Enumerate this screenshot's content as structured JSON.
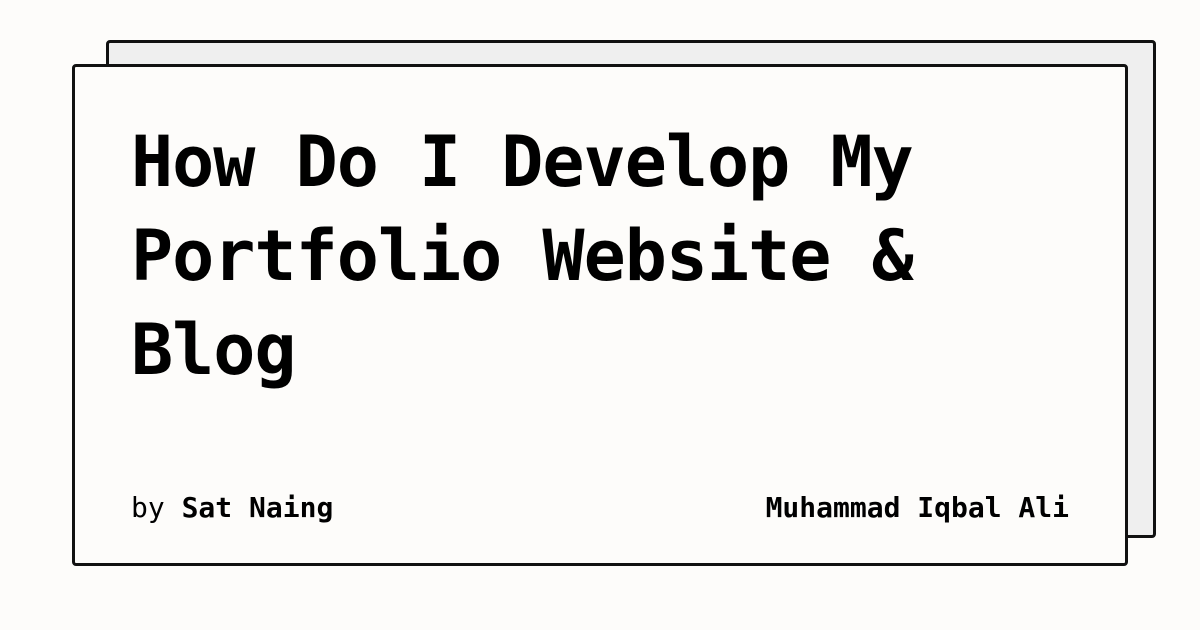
{
  "card": {
    "title": "How Do I Develop My Portfolio Website & Blog",
    "by_prefix": "by",
    "author": "Sat Naing",
    "site_name": "Muhammad Iqbal Ali"
  }
}
